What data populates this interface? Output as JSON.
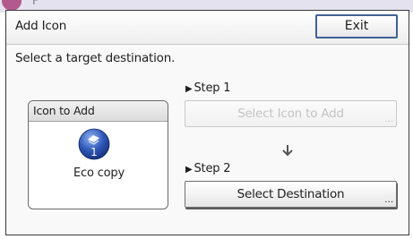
{
  "dialog": {
    "title": "Add Icon",
    "exit_label": "Exit",
    "instruction": "Select a target destination."
  },
  "icon_box": {
    "header": "Icon to Add",
    "icon_name": "eco-copy-icon",
    "icon_number": "1",
    "icon_label": "Eco copy"
  },
  "steps": [
    {
      "label": "Step 1",
      "button_label": "Select Icon to Add",
      "button_state": "disabled"
    },
    {
      "label": "Step 2",
      "button_label": "Select Destination",
      "button_state": "enabled"
    }
  ],
  "colors": {
    "accent_border": "#3f6296",
    "icon_blue": "#2f57b8",
    "disabled_text": "#c4c4c4"
  },
  "icons": {
    "step_marker": "triangle-right-icon",
    "flow_arrow": "arrow-down-icon",
    "more_options": "ellipsis-icon"
  }
}
